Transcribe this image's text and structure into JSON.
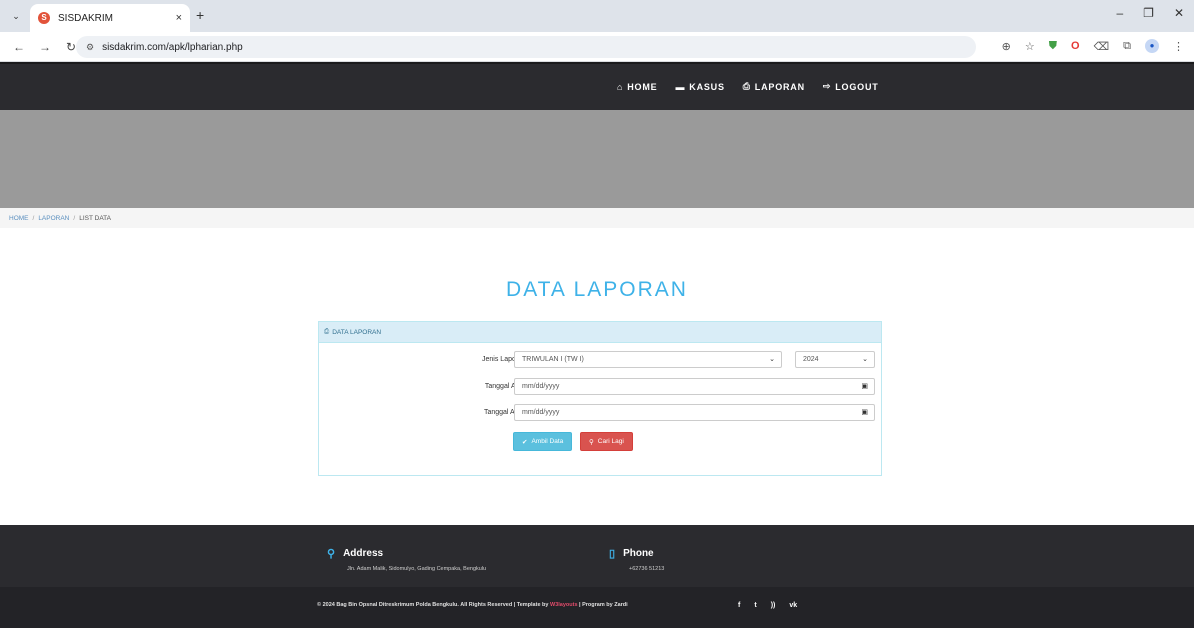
{
  "browser": {
    "tab_title": "SISDAKRIM",
    "tab_close": "×",
    "new_tab": "+",
    "url": "sisdakrim.com/apk/lpharian.php",
    "win_min": "–",
    "win_max": "❐",
    "win_close": "✕"
  },
  "nav": {
    "home": "HOME",
    "kasus": "KASUS",
    "laporan": "LAPORAN",
    "logout": "LOGOUT"
  },
  "breadcrumb": {
    "home": "HOME",
    "laporan": "LAPORAN",
    "current": "LIST DATA",
    "separator": "/"
  },
  "page_title": "DATA LAPORAN",
  "panel": {
    "heading": "DATA LAPORAN",
    "jenis_label": "Jenis Laporan",
    "jenis_value": "TRIWULAN I (TW I)",
    "year_value": "2024",
    "tanggal_awal_label": "Tanggal Awal",
    "tanggal_awal_placeholder": "mm/dd/yyyy",
    "tanggal_akhir_label": "Tanggal Akhir",
    "tanggal_akhir_placeholder": "mm/dd/yyyy",
    "ambil_button": "Ambil Data",
    "cari_button": "Cari Lagi"
  },
  "footer": {
    "address_title": "Address",
    "address_text": "Jln. Adam Malik, Sidomulyo, Gading Cempaka, Bengkulu",
    "phone_title": "Phone",
    "phone_text": "+62736 51213",
    "copyright_pre": "© 2024 Bag Bin Opsnal Ditreskrimum Polda Bengkulu. All Rights Reserved | Template by ",
    "copyright_link": "W3layouts",
    "copyright_post": " | Program by Zardi"
  },
  "colors": {
    "accent": "#3eb2e8",
    "nav_bg": "#2b2b2f",
    "panel_head": "#d9edf7",
    "btn_info": "#5bc0de",
    "btn_danger": "#d9534f"
  }
}
